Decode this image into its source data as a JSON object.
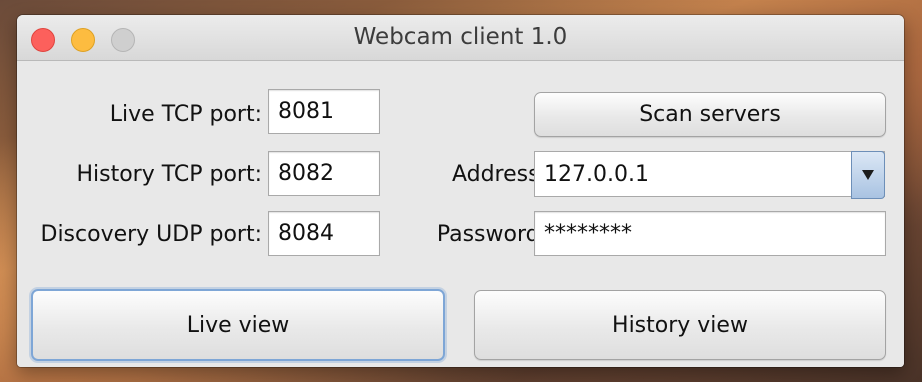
{
  "window": {
    "title": "Webcam client 1.0"
  },
  "form": {
    "live_tcp_label": "Live TCP port:",
    "live_tcp_value": "8081",
    "history_tcp_label": "History TCP port:",
    "history_tcp_value": "8082",
    "discovery_udp_label": "Discovery UDP port:",
    "discovery_udp_value": "8084",
    "address_label": "Address:",
    "address_value": "127.0.0.1",
    "password_label": "Password:",
    "password_value": "********"
  },
  "buttons": {
    "scan_servers": "Scan servers",
    "live_view": "Live view",
    "history_view": "History view"
  },
  "colors": {
    "close": "#fc605c",
    "minimize": "#fdbc40",
    "zoom_disabled": "#cfcfcf",
    "focus_ring": "#7ea6d6"
  },
  "icons": {
    "dropdown": "triangle-down"
  }
}
